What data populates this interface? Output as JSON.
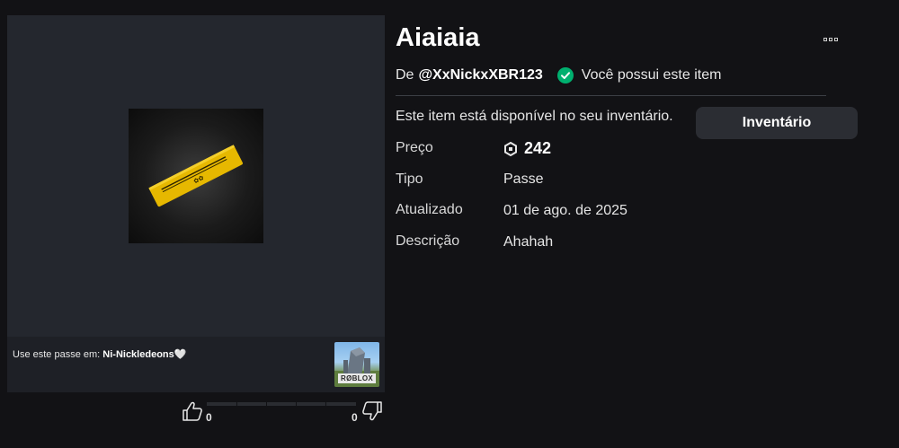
{
  "item": {
    "title": "Aiaiaia",
    "creator_prefix": "De",
    "creator": "@XxNickxXBR123",
    "owned_text": "Você possui este item",
    "available_text": "Este item está disponível no seu inventário.",
    "inventory_button": "Inventário",
    "more_icon": "ellipsis-icon",
    "owned_icon": "check-circle-icon",
    "details": {
      "price_label": "Preço",
      "price_value": "242",
      "price_icon": "robux-icon",
      "type_label": "Tipo",
      "type_value": "Passe",
      "updated_label": "Atualizado",
      "updated_value": "01 de ago. de 2025",
      "description_label": "Descrição",
      "description_value": "Ahahah"
    }
  },
  "usage": {
    "prefix": "Use este passe em: ",
    "game_name": "Ni-Nickledeons🤍",
    "game_logo_text": "RØBLOX"
  },
  "votes": {
    "up_count": "0",
    "down_count": "0",
    "up_icon": "thumbs-up-icon",
    "down_icon": "thumbs-down-icon"
  },
  "colors": {
    "background": "#121215",
    "panel": "#24272e",
    "accent_green": "#00b06f",
    "pass_gold": "#e6b800"
  }
}
